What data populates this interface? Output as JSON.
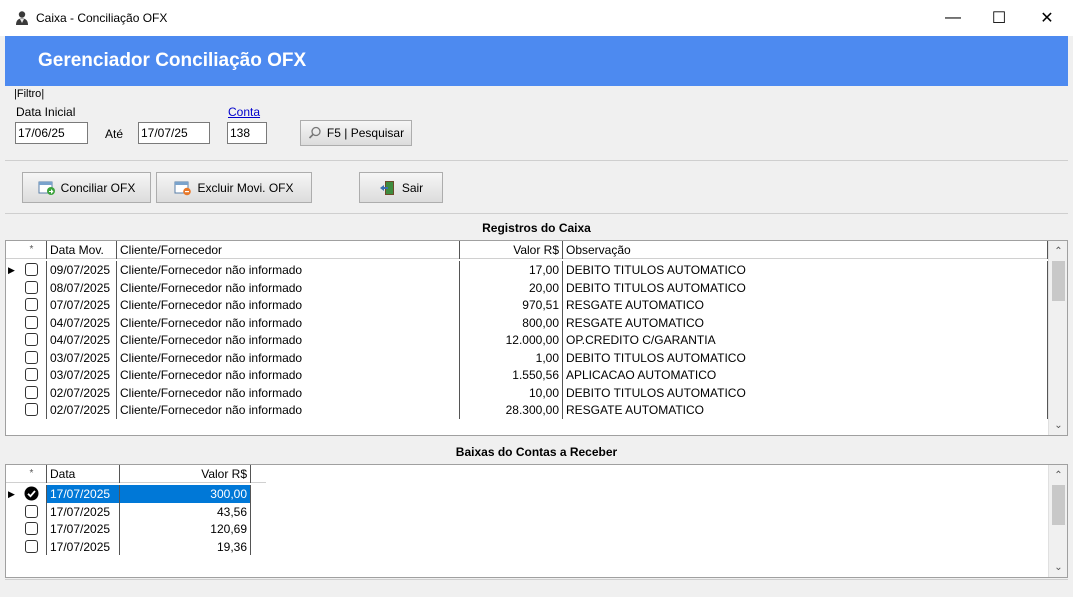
{
  "window": {
    "title": "Caixa - Conciliação OFX",
    "minimize": "—",
    "maximize": "☐",
    "close": "✕"
  },
  "banner": {
    "title": "Gerenciador Conciliação OFX"
  },
  "filtro": {
    "legend": "Filtro",
    "data_inicial_label": "Data Inicial",
    "data_inicial_value": "17/06/25",
    "ate_label": "Até",
    "data_final_value": "17/07/25",
    "conta_label": "Conta",
    "conta_value": "138",
    "pesquisar_label": "F5 | Pesquisar"
  },
  "actions": {
    "conciliar_label": "Conciliar OFX",
    "excluir_label": "Excluir Movi. OFX",
    "sair_label": "Sair"
  },
  "registros": {
    "title": "Registros do Caixa",
    "columns": [
      "*",
      "Data Mov.",
      "Cliente/Fornecedor",
      "Valor R$",
      "Observação"
    ],
    "rows": [
      {
        "data": "09/07/2025",
        "cliente": "Cliente/Fornecedor não informado",
        "valor": "17,00",
        "obs": "DEBITO TITULOS AUTOMATICO"
      },
      {
        "data": "08/07/2025",
        "cliente": "Cliente/Fornecedor não informado",
        "valor": "20,00",
        "obs": "DEBITO TITULOS AUTOMATICO"
      },
      {
        "data": "07/07/2025",
        "cliente": "Cliente/Fornecedor não informado",
        "valor": "970,51",
        "obs": "RESGATE AUTOMATICO"
      },
      {
        "data": "04/07/2025",
        "cliente": "Cliente/Fornecedor não informado",
        "valor": "800,00",
        "obs": "RESGATE AUTOMATICO"
      },
      {
        "data": "04/07/2025",
        "cliente": "Cliente/Fornecedor não informado",
        "valor": "12.000,00",
        "obs": "OP.CREDITO C/GARANTIA"
      },
      {
        "data": "03/07/2025",
        "cliente": "Cliente/Fornecedor não informado",
        "valor": "1,00",
        "obs": "DEBITO TITULOS AUTOMATICO"
      },
      {
        "data": "03/07/2025",
        "cliente": "Cliente/Fornecedor não informado",
        "valor": "1.550,56",
        "obs": "APLICACAO AUTOMATICO"
      },
      {
        "data": "02/07/2025",
        "cliente": "Cliente/Fornecedor não informado",
        "valor": "10,00",
        "obs": "DEBITO TITULOS AUTOMATICO"
      },
      {
        "data": "02/07/2025",
        "cliente": "Cliente/Fornecedor não informado",
        "valor": "28.300,00",
        "obs": "RESGATE AUTOMATICO"
      }
    ]
  },
  "baixas": {
    "title": "Baixas do Contas a Receber",
    "columns": [
      "*",
      "Data",
      "Valor R$"
    ],
    "rows": [
      {
        "data": "17/07/2025",
        "valor": "300,00",
        "checked": true
      },
      {
        "data": "17/07/2025",
        "valor": "43,56",
        "checked": false
      },
      {
        "data": "17/07/2025",
        "valor": "120,69",
        "checked": false
      },
      {
        "data": "17/07/2025",
        "valor": "19,36",
        "checked": false
      }
    ]
  },
  "colors": {
    "banner": "#4d8af0",
    "selection": "#0078d7"
  }
}
